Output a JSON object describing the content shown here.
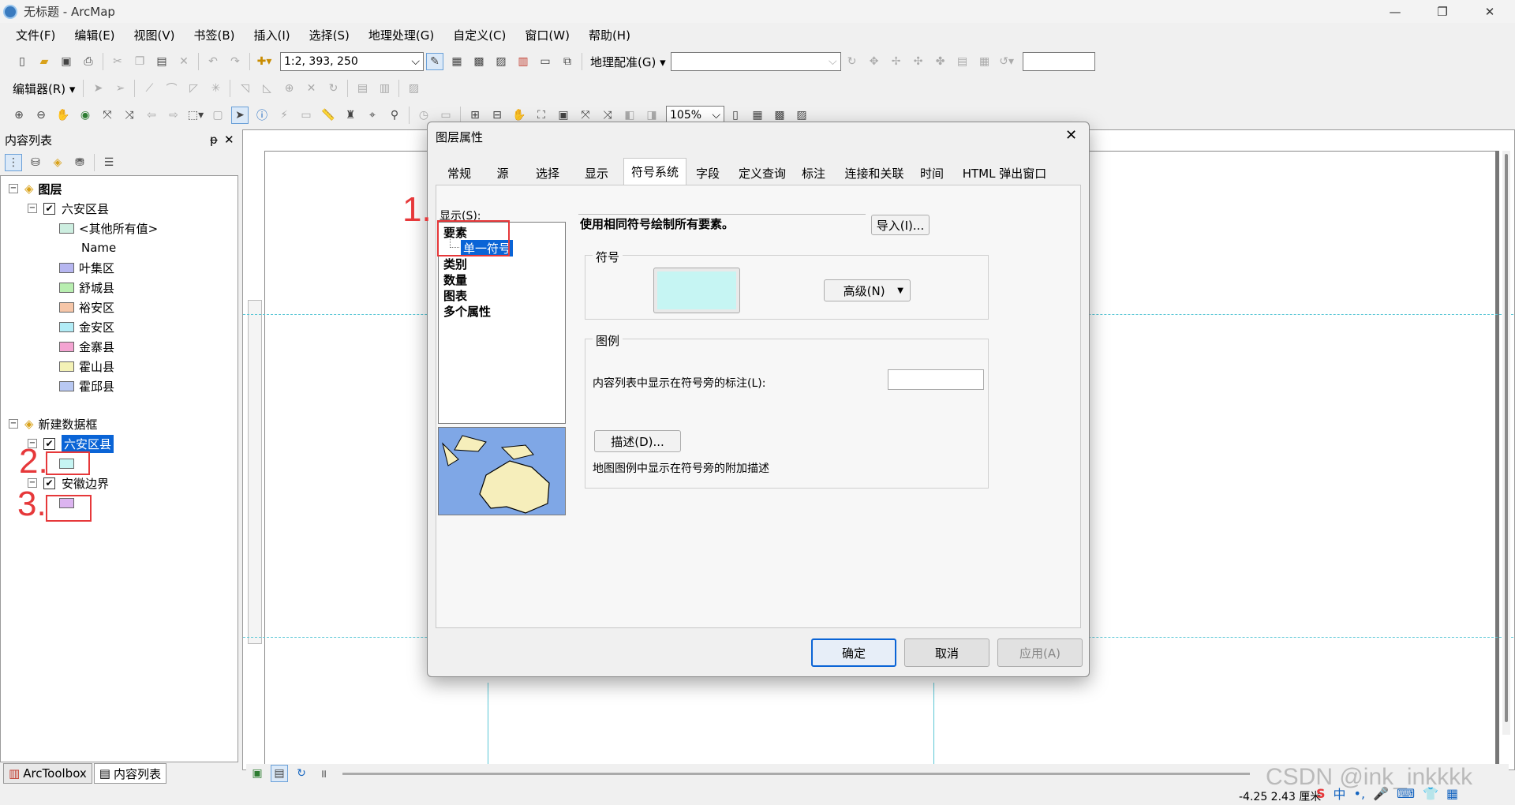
{
  "window": {
    "title": "无标题 - ArcMap",
    "min": "—",
    "max": "❐",
    "close": "✕"
  },
  "menu": [
    "文件(F)",
    "编辑(E)",
    "视图(V)",
    "书签(B)",
    "插入(I)",
    "选择(S)",
    "地理处理(G)",
    "自定义(C)",
    "窗口(W)",
    "帮助(H)"
  ],
  "toolbar": {
    "scale": "1:2, 393, 250",
    "georef_label": "地理配准(G)",
    "editor_label": "编辑器(R)",
    "zoom_pct": "105%"
  },
  "toc": {
    "title": "内容列表",
    "pin": "ᵽ",
    "close": "✕",
    "groups": [
      {
        "name": "图层",
        "layer": "六安区县",
        "other_label": "<其他所有值>",
        "field_label": "Name",
        "items": [
          {
            "label": "叶集区",
            "color": "#b6b6f0"
          },
          {
            "label": "舒城县",
            "color": "#b8eeb0"
          },
          {
            "label": "裕安区",
            "color": "#f6c6a8"
          },
          {
            "label": "金安区",
            "color": "#b2ecf6"
          },
          {
            "label": "金寨县",
            "color": "#f4a4d2"
          },
          {
            "label": "霍山县",
            "color": "#f4f2b6"
          },
          {
            "label": "霍邱县",
            "color": "#b8c8f2"
          }
        ]
      },
      {
        "name": "新建数据框",
        "layer1": "六安区县",
        "layer1_color": "#c6f5f3",
        "layer2": "安徽边界",
        "layer2_color": "#dcb4f0"
      }
    ],
    "bottom_tabs": [
      "ArcToolbox",
      "内容列表"
    ]
  },
  "annotations": {
    "n1": "1.",
    "n2": "2.",
    "n3": "3."
  },
  "dialog": {
    "title": "图层属性",
    "close": "✕",
    "tabs": [
      "常规",
      "源",
      "选择",
      "显示",
      "符号系统",
      "字段",
      "定义查询",
      "标注",
      "连接和关联",
      "时间",
      "HTML 弹出窗口"
    ],
    "active_tab": "符号系统",
    "show_label": "显示(S):",
    "show_items": [
      "要素",
      "单一符号",
      "类别",
      "数量",
      "图表",
      "多个属性"
    ],
    "heading": "使用相同符号绘制所有要素。",
    "import_btn": "导入(I)...",
    "symbol_group": "符号",
    "symbol_color": "#c6f5f3",
    "advanced_btn": "高级(N)",
    "legend_group": "图例",
    "legend_label": "内容列表中显示在符号旁的标注(L):",
    "describe_btn": "描述(D)...",
    "describe_text": "地图图例中显示在符号旁的附加描述",
    "ok": "确定",
    "cancel": "取消",
    "apply": "应用(A)"
  },
  "status": {
    "coords": "-4.25  2.43 厘米"
  },
  "watermark": "CSDN @ink_inkkkk"
}
